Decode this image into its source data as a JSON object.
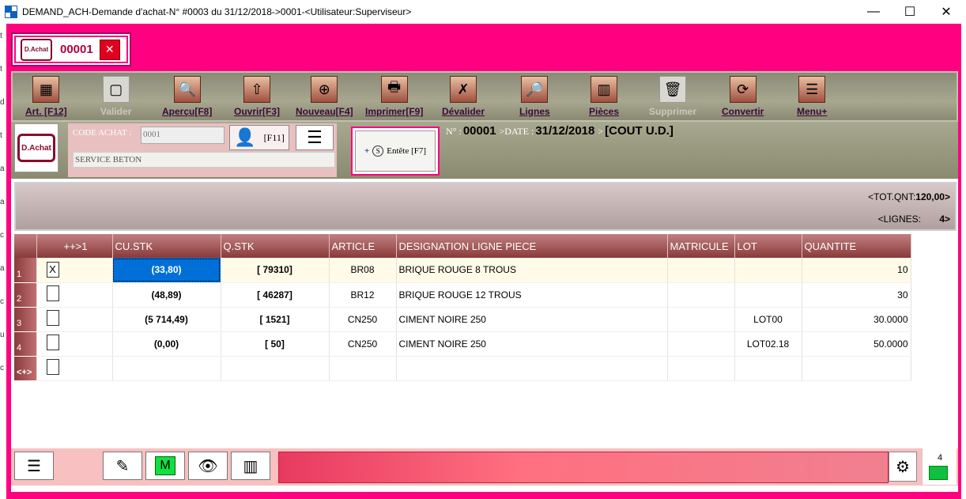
{
  "window": {
    "title": "DEMAND_ACH-Demande d'achat-N° #0003 du 31/12/2018->0001-<Utilisateur:Superviseur>",
    "minimize": "—",
    "maximize": "☐",
    "close": "✕"
  },
  "left_strip_marks": [
    "t",
    "t",
    "d",
    "t",
    "a",
    "a",
    "c",
    "a",
    "c",
    "u",
    "c"
  ],
  "header": {
    "logo_text": "D.Achat",
    "doc_number": "00001",
    "close_glyph": "✕"
  },
  "toolbar": {
    "items": [
      {
        "label": "Art. [F12]",
        "icon": "articles-icon",
        "glyph": "▦",
        "enabled": true
      },
      {
        "label": "Valider",
        "icon": "validate-icon",
        "glyph": "▢",
        "enabled": false
      },
      {
        "label": "Aperçu[F8]",
        "icon": "preview-icon",
        "glyph": "🔍",
        "enabled": true
      },
      {
        "label": "Ouvrir[F3]",
        "icon": "open-icon",
        "glyph": "⇧",
        "enabled": true
      },
      {
        "label": "Nouveau[F4]",
        "icon": "new-icon",
        "glyph": "⊕",
        "enabled": true
      },
      {
        "label": "Imprimer[F9]",
        "icon": "print-icon",
        "glyph": "🖶",
        "enabled": true
      },
      {
        "label": "Dévalider",
        "icon": "unvalidate-icon",
        "glyph": "✗",
        "enabled": true
      },
      {
        "label": "Lignes",
        "icon": "lines-icon",
        "glyph": "🔎",
        "enabled": true
      },
      {
        "label": "Pièces",
        "icon": "parts-icon",
        "glyph": "▥",
        "enabled": true
      },
      {
        "label": "Supprimer",
        "icon": "delete-icon",
        "glyph": "🗑",
        "enabled": false
      },
      {
        "label": "Convertir",
        "icon": "convert-icon",
        "glyph": "⟳",
        "enabled": true
      },
      {
        "label": "Menu+",
        "icon": "menu-plus-icon",
        "glyph": "☰",
        "enabled": true
      }
    ]
  },
  "info": {
    "logo_text": "D.Achat",
    "code_label": "CODE ACHAT :",
    "code_value": "0001",
    "user_key": "[F11]",
    "service_value": "SERVICE BETON",
    "entete_plus": "+",
    "entete_s": "S",
    "entete_label": "Entête [F7]",
    "doc_no_label": "N° :",
    "doc_no_value": "00001",
    "date_label": ">DATE :",
    "date_value": "31/12/2018",
    "cost_sep": ">",
    "cost_value": "[COUT U.D.]"
  },
  "totals": {
    "tot_qnt_label": "<TOT.QNT:",
    "tot_qnt_value": "120,00>",
    "lignes_label": "<LIGNES:",
    "lignes_value": "4>"
  },
  "grid": {
    "columns": [
      "",
      "++>1",
      "CU.STK",
      "Q.STK",
      "ARTICLE",
      "DESIGNATION LIGNE PIECE",
      "MATRICULE",
      "LOT",
      "QUANTITE"
    ],
    "rows": [
      {
        "num": "1",
        "checked": "X",
        "cu": "(33,80)",
        "q": "[ 79310]",
        "article": "BR08",
        "designation": "BRIQUE ROUGE 8 TROUS",
        "matricule": "",
        "lot": "",
        "quantite": "10"
      },
      {
        "num": "2",
        "checked": "",
        "cu": "(48,89)",
        "q": "[ 46287]",
        "article": "BR12",
        "designation": "BRIQUE ROUGE 12 TROUS",
        "matricule": "",
        "lot": "",
        "quantite": "30"
      },
      {
        "num": "3",
        "checked": "",
        "cu": "(5 714,49)",
        "q": "[ 1521]",
        "article": "CN250",
        "designation": "CIMENT NOIRE 250",
        "matricule": "",
        "lot": "LOT00",
        "quantite": "30.0000"
      },
      {
        "num": "4",
        "checked": "",
        "cu": "(0,00)",
        "q": "[ 50]",
        "article": "CN250",
        "designation": "CIMENT NOIRE 250",
        "matricule": "",
        "lot": "LOT02.18",
        "quantite": "50.0000"
      },
      {
        "num": "<+>",
        "checked": "",
        "cu": "",
        "q": "",
        "article": "",
        "designation": "",
        "matricule": "",
        "lot": "",
        "quantite": ""
      }
    ]
  },
  "footer": {
    "menu_glyph": "☰",
    "edit_glyph": "✎",
    "m_glyph": "M",
    "eye_glyph": "👁",
    "barcode_glyph": "▥",
    "settings_glyph": "⚙",
    "mail_count": "4"
  },
  "colors": {
    "frame": "#ff0080",
    "grid_header": "#8a3a3a",
    "selected_cell": "#0070d8",
    "toolbar": "#a8a890"
  }
}
